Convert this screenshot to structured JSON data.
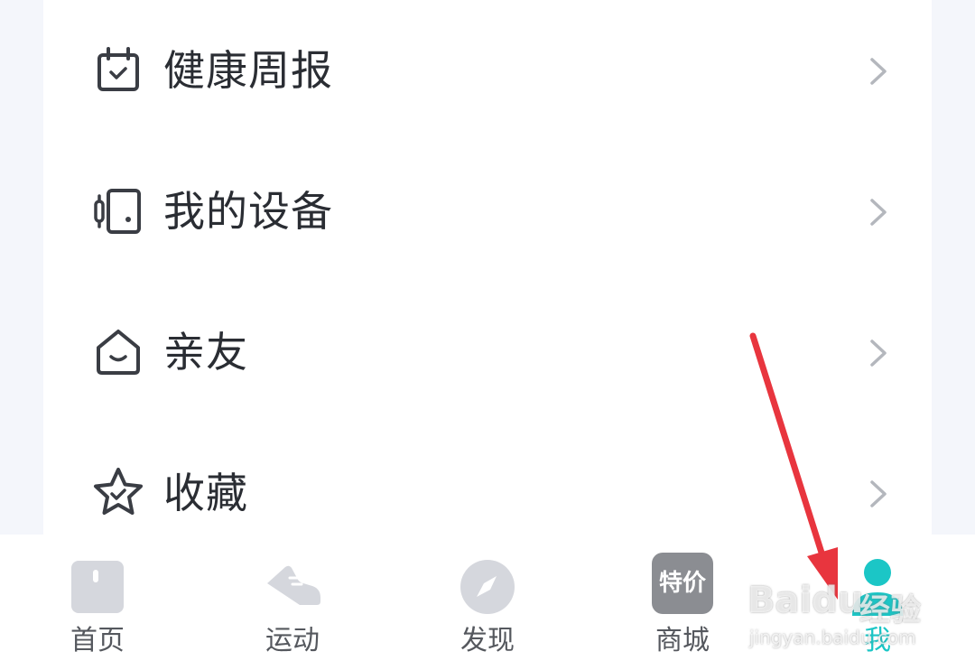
{
  "menu": {
    "items": [
      {
        "label": "健康周报",
        "icon": "calendar-check-icon"
      },
      {
        "label": "我的设备",
        "icon": "device-icon"
      },
      {
        "label": "亲友",
        "icon": "home-smile-icon"
      },
      {
        "label": "收藏",
        "icon": "star-check-icon"
      }
    ]
  },
  "tabbar": {
    "tabs": [
      {
        "label": "首页",
        "icon": "home-square-icon"
      },
      {
        "label": "运动",
        "icon": "shoe-icon"
      },
      {
        "label": "发现",
        "icon": "compass-icon"
      },
      {
        "label": "商城",
        "icon": "special-price-icon",
        "badge": "特价"
      },
      {
        "label": "我",
        "icon": "person-icon",
        "active": true
      }
    ]
  },
  "watermark": {
    "brand": "Baidu",
    "brand_cn": "经验",
    "url": "jingyan.baidu.com"
  },
  "colors": {
    "accent": "#1bc6c6",
    "annotation_arrow": "#e8353e",
    "icon_gray": "#d5d7dd",
    "text": "#2a2d33"
  }
}
